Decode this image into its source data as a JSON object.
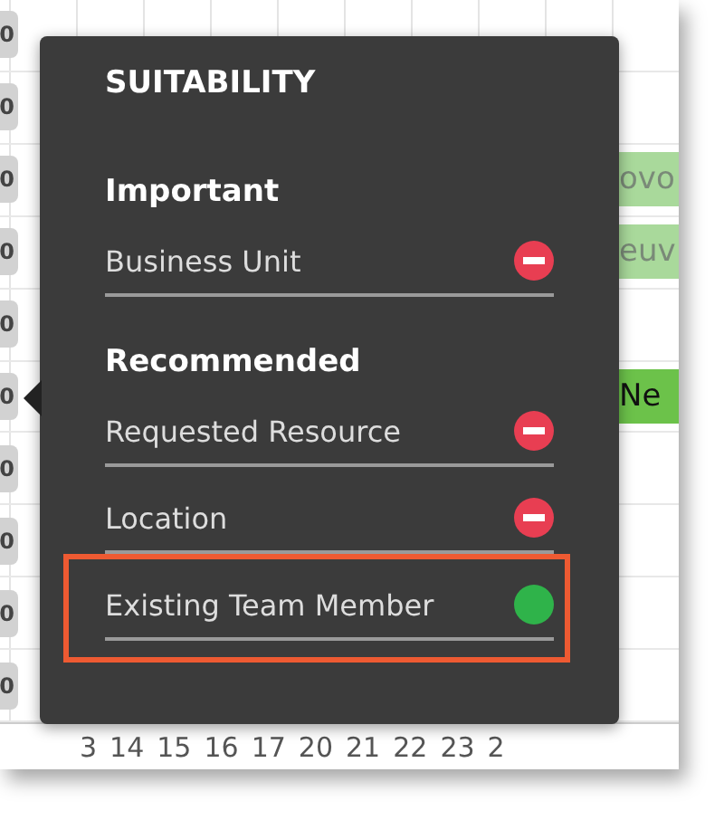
{
  "gantt": {
    "rows": [
      {
        "badge": "0"
      },
      {
        "badge": "0"
      },
      {
        "badge": "0",
        "bar": {
          "text": "ovo",
          "kind": "light"
        }
      },
      {
        "badge": "0",
        "bar": {
          "text": "euv",
          "kind": "light"
        }
      },
      {
        "badge": "0"
      },
      {
        "badge": "0",
        "bar": {
          "text": "Ne",
          "kind": "strong"
        }
      },
      {
        "badge": "0"
      },
      {
        "badge": "0"
      },
      {
        "badge": "0"
      },
      {
        "badge": "0"
      }
    ],
    "axis_ticks": [
      "3",
      "14",
      "15",
      "16",
      "17",
      "20",
      "21",
      "22",
      "23",
      "2"
    ]
  },
  "tooltip": {
    "title": "SUITABILITY",
    "groups": [
      {
        "heading": "Important",
        "criteria": [
          {
            "label": "Business Unit",
            "met": false,
            "highlighted": false
          }
        ]
      },
      {
        "heading": "Recommended",
        "criteria": [
          {
            "label": "Requested Resource",
            "met": false,
            "highlighted": false
          },
          {
            "label": "Location",
            "met": false,
            "highlighted": false
          },
          {
            "label": "Existing Team Member",
            "met": true,
            "highlighted": true
          }
        ]
      }
    ]
  }
}
